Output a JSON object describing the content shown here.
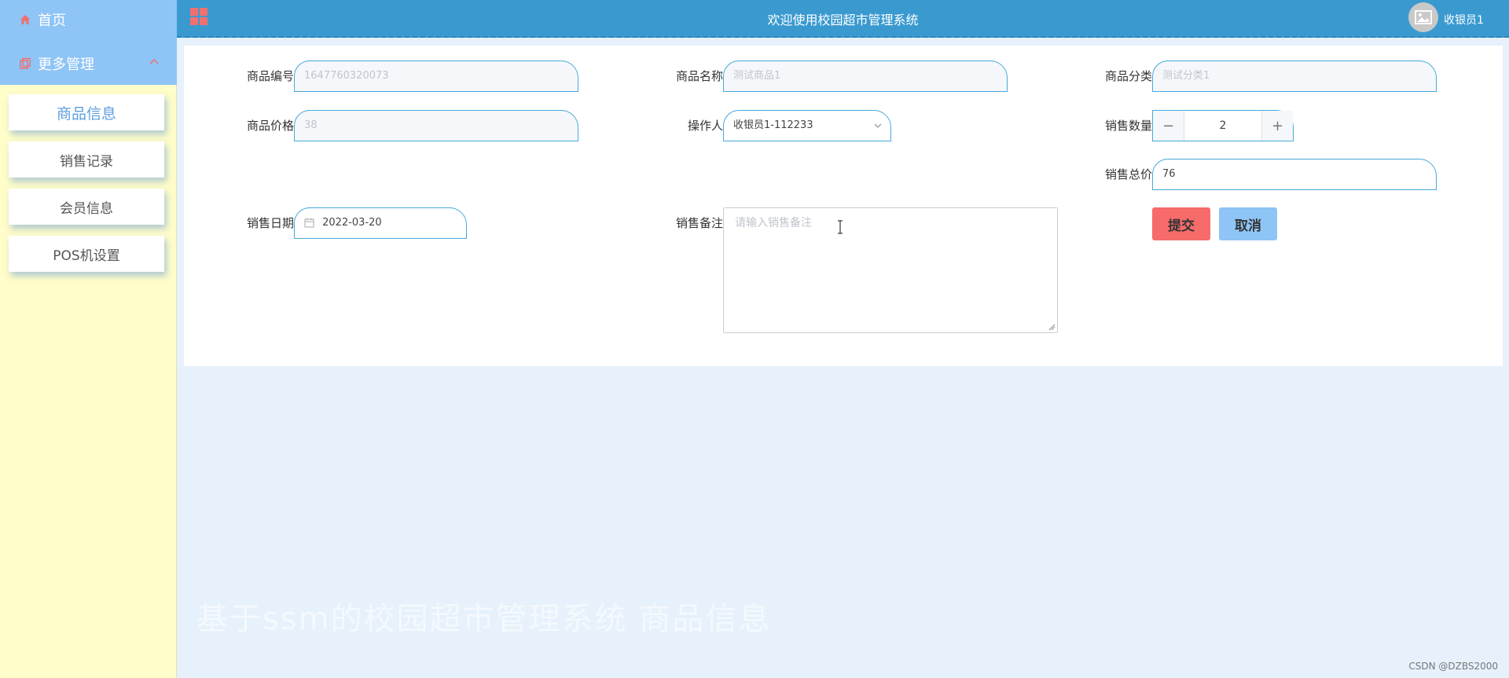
{
  "header": {
    "title": "欢迎使用校园超市管理系统",
    "user": "收银员1"
  },
  "sidebar": {
    "home": "首页",
    "more": "更多管理",
    "items": [
      {
        "label": "商品信息",
        "active": true
      },
      {
        "label": "销售记录",
        "active": false
      },
      {
        "label": "会员信息",
        "active": false
      },
      {
        "label": "POS机设置",
        "active": false
      }
    ]
  },
  "form": {
    "product_code": {
      "label": "商品编号",
      "value": "1647760320073"
    },
    "product_name": {
      "label": "商品名称",
      "value": "测试商品1"
    },
    "product_category": {
      "label": "商品分类",
      "value": "测试分类1"
    },
    "product_price": {
      "label": "商品价格",
      "value": "38"
    },
    "operator": {
      "label": "操作人",
      "value": "收银员1-112233"
    },
    "sale_quantity": {
      "label": "销售数量",
      "value": "2"
    },
    "sale_total": {
      "label": "销售总价",
      "value": "76"
    },
    "sale_date": {
      "label": "销售日期",
      "value": "2022-03-20"
    },
    "sale_remark": {
      "label": "销售备注",
      "placeholder": "请输入销售备注"
    }
  },
  "buttons": {
    "submit": "提交",
    "cancel": "取消"
  },
  "watermark": "基于ssm的校园超市管理系统 商品信息",
  "credit": "CSDN @DZBS2000",
  "colors": {
    "header": "#3a9ad0",
    "sidebar_top": "#8ec4f6",
    "sidebar": "#fffdc9",
    "input_border": "#45a9dc",
    "submit": "#f76b6b",
    "cancel": "#8ec4f6"
  }
}
